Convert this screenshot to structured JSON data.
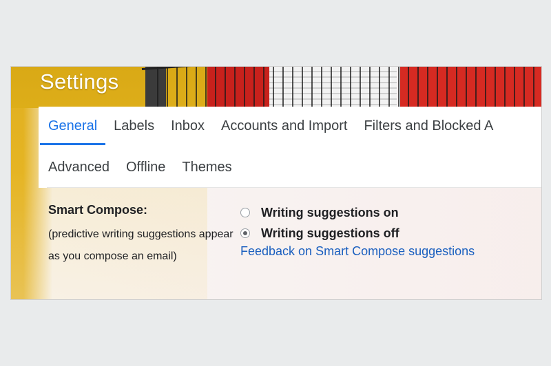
{
  "header": {
    "title": "Settings"
  },
  "tabs_row1": [
    "General",
    "Labels",
    "Inbox",
    "Accounts and Import",
    "Filters and Blocked A"
  ],
  "tabs_row2": [
    "Advanced",
    "Offline",
    "Themes"
  ],
  "active_tab": "General",
  "smart_compose": {
    "label": "Smart Compose:",
    "description": "(predictive writing suggestions appear as you compose an email)",
    "option_on": "Writing suggestions on",
    "option_off": "Writing suggestions off",
    "selected": "Writing suggestions off",
    "feedback_link": "Feedback on Smart Compose suggestions"
  },
  "colors": {
    "accent": "#1a73e8",
    "link": "#1a5fbf"
  }
}
